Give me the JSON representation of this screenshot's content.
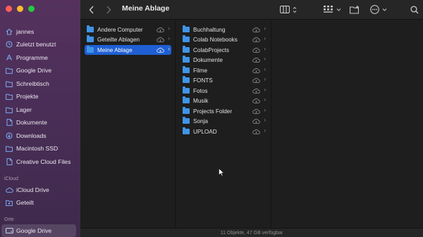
{
  "window": {
    "title": "Meine Ablage",
    "status": "11 Objekte, 47 GB verfügbar",
    "colors": {
      "sidebar": "#4a2e57",
      "selection": "#1f5fd3",
      "folder": "#3f95e6"
    }
  },
  "toolbar": {
    "back_icon": "chevron-left-icon",
    "forward_icon": "chevron-right-icon",
    "view_icon": "column-view-icon",
    "group_icon": "grid-group-icon",
    "new_folder_icon": "new-folder-icon",
    "more_icon": "ellipsis-icon",
    "search_icon": "search-icon"
  },
  "sidebar": {
    "favorites": [
      {
        "label": "jannes",
        "icon": "home-icon"
      },
      {
        "label": "Zuletzt benutzt",
        "icon": "clock-icon"
      },
      {
        "label": "Programme",
        "icon": "apps-icon"
      },
      {
        "label": "Google Drive",
        "icon": "folder-icon"
      },
      {
        "label": "Schreibtisch",
        "icon": "folder-icon"
      },
      {
        "label": "Projekte",
        "icon": "folder-icon"
      },
      {
        "label": "Lager",
        "icon": "folder-icon"
      },
      {
        "label": "Dokumente",
        "icon": "document-icon"
      },
      {
        "label": "Downloads",
        "icon": "download-icon"
      },
      {
        "label": "Macintosh SSD",
        "icon": "folder-icon"
      },
      {
        "label": "Creative Cloud Files",
        "icon": "document-icon"
      }
    ],
    "icloud_header": "iCloud",
    "icloud": [
      {
        "label": "iCloud Drive",
        "icon": "cloud-icon"
      },
      {
        "label": "Geteilt",
        "icon": "shared-folder-icon"
      }
    ],
    "locations_header": "Orte",
    "locations": [
      {
        "label": "Google Drive",
        "icon": "drive-icon",
        "selected": true
      }
    ]
  },
  "column1": {
    "items": [
      {
        "label": "Andere Computer",
        "selected": false
      },
      {
        "label": "Geteilte Ablagen",
        "selected": false
      },
      {
        "label": "Meine Ablage",
        "selected": true
      }
    ]
  },
  "column2": {
    "items": [
      {
        "label": "Buchhaltung"
      },
      {
        "label": "Colab Notebooks"
      },
      {
        "label": "ColabProjects"
      },
      {
        "label": "Dokumente"
      },
      {
        "label": "Filme"
      },
      {
        "label": "FONTS"
      },
      {
        "label": "Fotos"
      },
      {
        "label": "Musik"
      },
      {
        "label": "Projects Folder"
      },
      {
        "label": "Sonja"
      },
      {
        "label": "UPLOAD"
      }
    ]
  }
}
